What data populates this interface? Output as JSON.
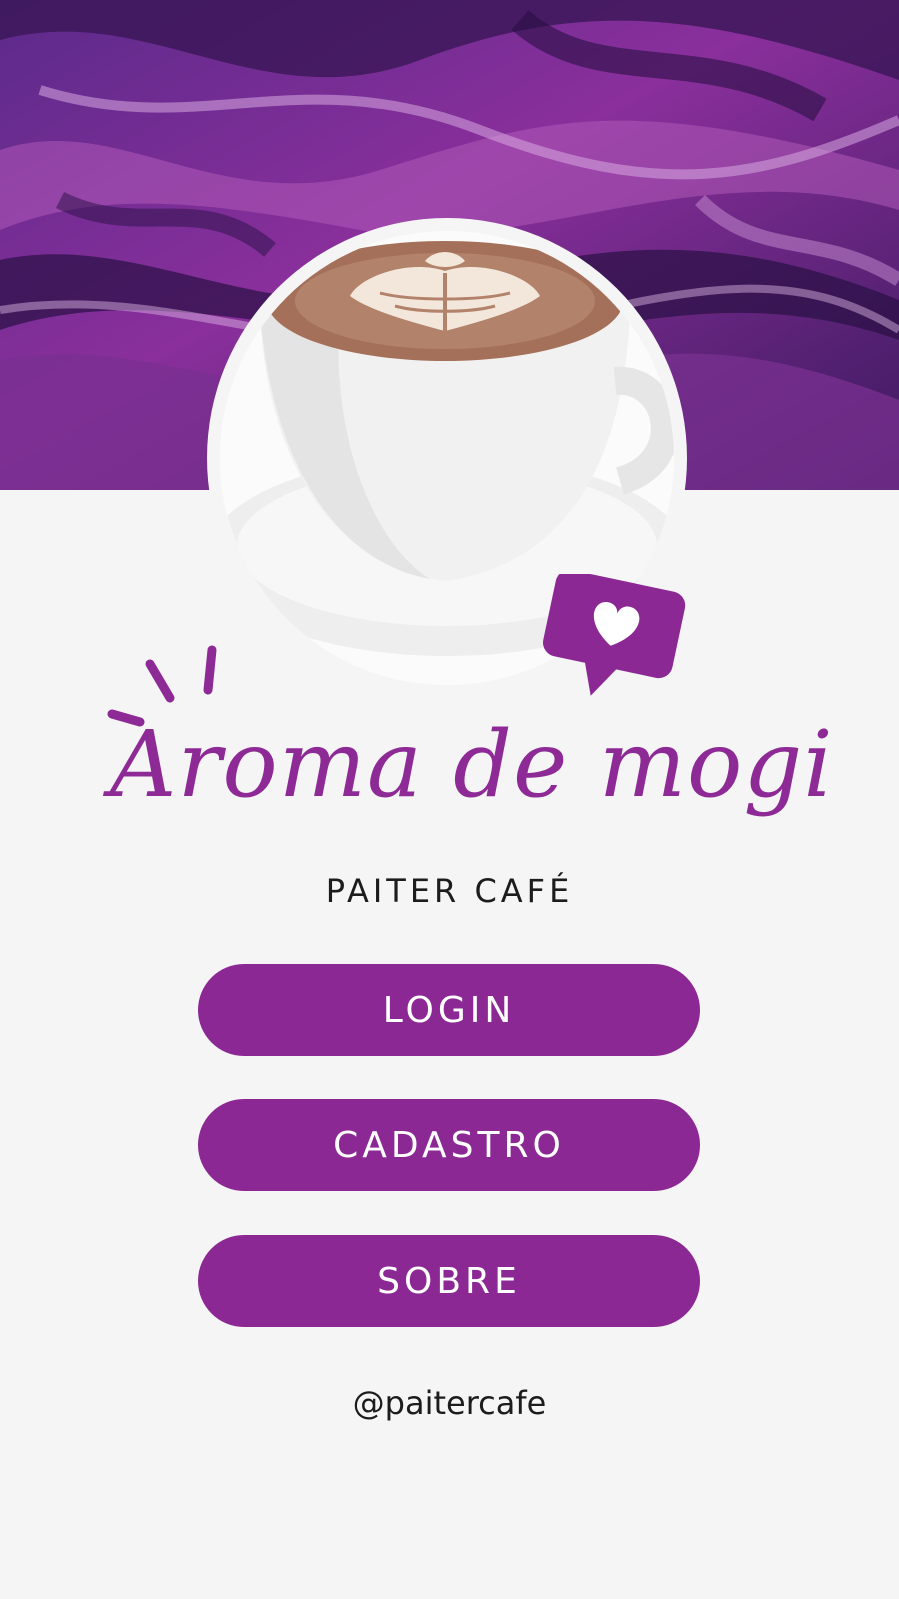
{
  "app": {
    "title": "Aroma de mogi",
    "subtitle": "PAITER CAFÉ",
    "handle": "@paitercafe"
  },
  "buttons": {
    "login": "LOGIN",
    "cadastro": "CADASTRO",
    "sobre": "SOBRE"
  },
  "icons": {
    "badge": "heart-chat-icon",
    "sparks": "sparkle-lines-icon"
  },
  "colors": {
    "accent": "#8b2894",
    "title": "#8e2a96",
    "background": "#f5f5f6",
    "text": "#1c1c1c"
  }
}
